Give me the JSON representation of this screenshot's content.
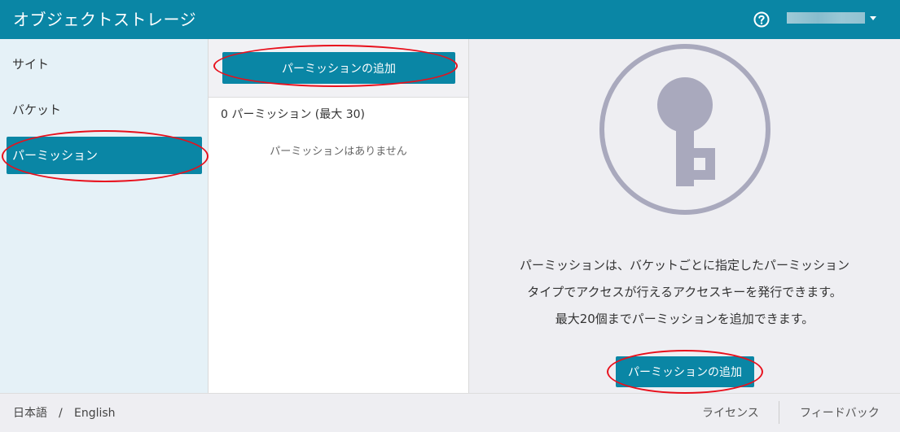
{
  "header": {
    "title": "オブジェクトストレージ",
    "help_icon": "question-circle-icon",
    "user_caret_icon": "caret-down-icon"
  },
  "sidebar": {
    "items": [
      {
        "label": "サイト",
        "active": false
      },
      {
        "label": "バケット",
        "active": false
      },
      {
        "label": "パーミッション",
        "active": true
      }
    ]
  },
  "middle": {
    "add_button_label": "パーミッションの追加",
    "count_label": "0 パーミッション (最大 30)",
    "empty_label": "パーミッションはありません"
  },
  "detail": {
    "illustration_icon": "key-icon",
    "description_lines": [
      "パーミッションは、バケットごとに指定したパーミッション",
      "タイプでアクセスが行えるアクセスキーを発行できます。",
      "最大20個までパーミッションを追加できます。"
    ],
    "add_button_label": "パーミッションの追加"
  },
  "footer": {
    "lang_ja": "日本語",
    "lang_separator": "/",
    "lang_en": "English",
    "license_label": "ライセンス",
    "feedback_label": "フィードバック"
  },
  "colors": {
    "primary": "#0a86a5",
    "sidebar_bg": "#e5f1f7",
    "panel_bg": "#eeeef2",
    "illustration": "#a9a9bd",
    "annotation": "#e8101c"
  }
}
